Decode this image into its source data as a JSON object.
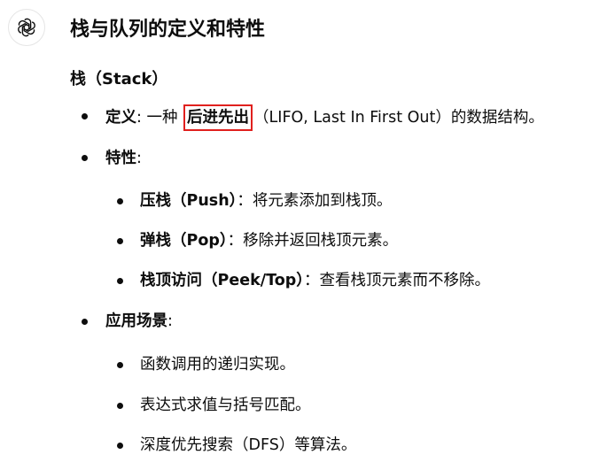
{
  "title": "栈与队列的定义和特性",
  "subhead": "栈（Stack）",
  "definition": {
    "label": "定义",
    "sep": ": 一种",
    "highlight": "后进先出",
    "rest": "（LIFO, Last In First Out）的数据结构。"
  },
  "features": {
    "label": "特性",
    "sep": ":",
    "items": [
      {
        "term": "压栈（Push）",
        "desc": "：将元素添加到栈顶。"
      },
      {
        "term": "弹栈（Pop）",
        "desc": "：移除并返回栈顶元素。"
      },
      {
        "term": "栈顶访问（Peek/Top）",
        "desc": "：查看栈顶元素而不移除。"
      }
    ]
  },
  "applications": {
    "label": "应用场景",
    "sep": ":",
    "items": [
      "函数调用的递归实现。",
      "表达式求值与括号匹配。",
      "深度优先搜索（DFS）等算法。"
    ]
  },
  "colors": {
    "highlight_border": "#e0201e",
    "text": "#0d0d0d"
  },
  "icons": {
    "avatar": "openai-logo-icon"
  }
}
